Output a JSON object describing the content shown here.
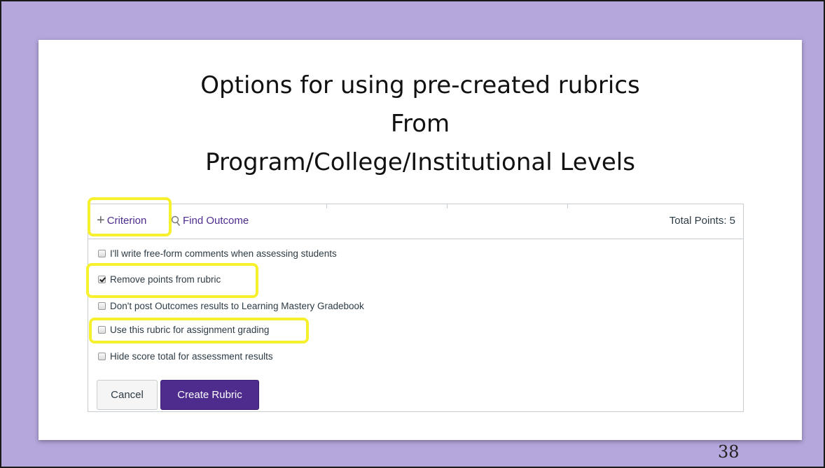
{
  "slide": {
    "title_lines": [
      "Options for using pre-created rubrics",
      "From",
      "Program/College/Institutional Levels"
    ],
    "page_number": "38"
  },
  "rubric_form": {
    "toolbar": {
      "criterion_label": "Criterion",
      "find_outcome_label": "Find Outcome",
      "total_points": "Total Points: 5"
    },
    "options": [
      {
        "label": "I'll write free-form comments when assessing students",
        "checked": false,
        "highlighted": false
      },
      {
        "label": "Remove points from rubric",
        "checked": true,
        "highlighted": true
      },
      {
        "label": "Don't post Outcomes results to Learning Mastery Gradebook",
        "checked": false,
        "highlighted": false
      },
      {
        "label": "Use this rubric for assignment grading",
        "checked": false,
        "highlighted": true
      },
      {
        "label": "Hide score total for assessment results",
        "checked": false,
        "highlighted": false
      }
    ],
    "buttons": {
      "cancel_label": "Cancel",
      "create_label": "Create Rubric"
    }
  },
  "colors": {
    "background": "#b5a6dc",
    "highlight": "#f6f02d",
    "accent": "#4d2c8e"
  }
}
